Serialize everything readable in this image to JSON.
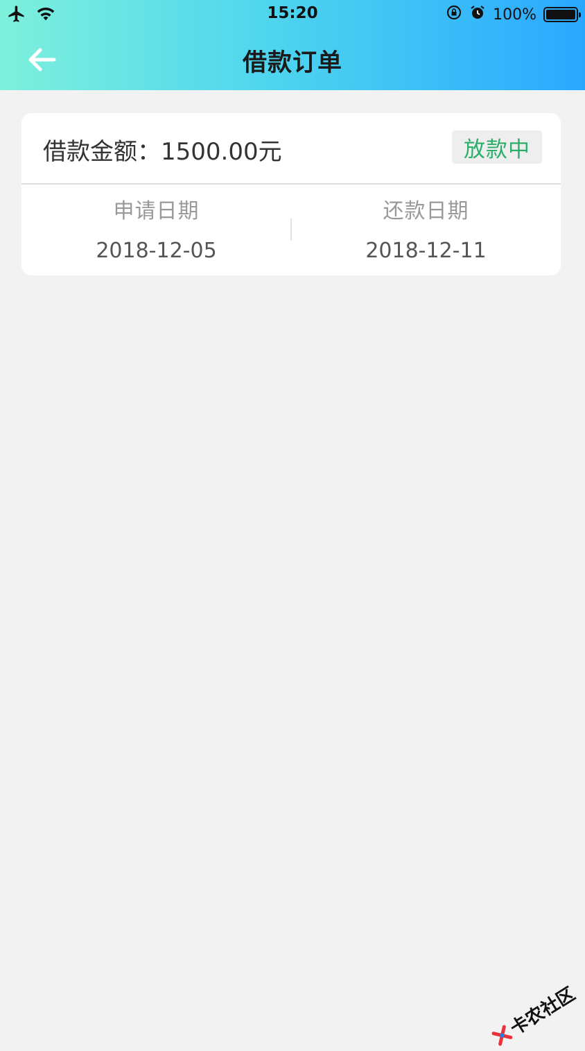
{
  "status_bar": {
    "time": "15:20",
    "battery_percent": "100%",
    "icons": [
      "airplane-icon",
      "wifi-icon",
      "rotation-lock-icon",
      "alarm-icon",
      "battery-icon"
    ]
  },
  "header": {
    "title": "借款订单",
    "back_icon": "arrow-left-icon",
    "gradient_colors": [
      "#7ef0dc",
      "#4fd6ee",
      "#2aa8ff"
    ]
  },
  "order": {
    "amount_label": "借款金额：1500.00元",
    "status": "放款中",
    "status_color": "#2cae6b",
    "apply_date_label": "申请日期",
    "apply_date": "2018-12-05",
    "repay_date_label": "还款日期",
    "repay_date": "2018-12-11"
  },
  "watermark": {
    "text": "卡农社区",
    "icon": "brand-logo-icon"
  }
}
